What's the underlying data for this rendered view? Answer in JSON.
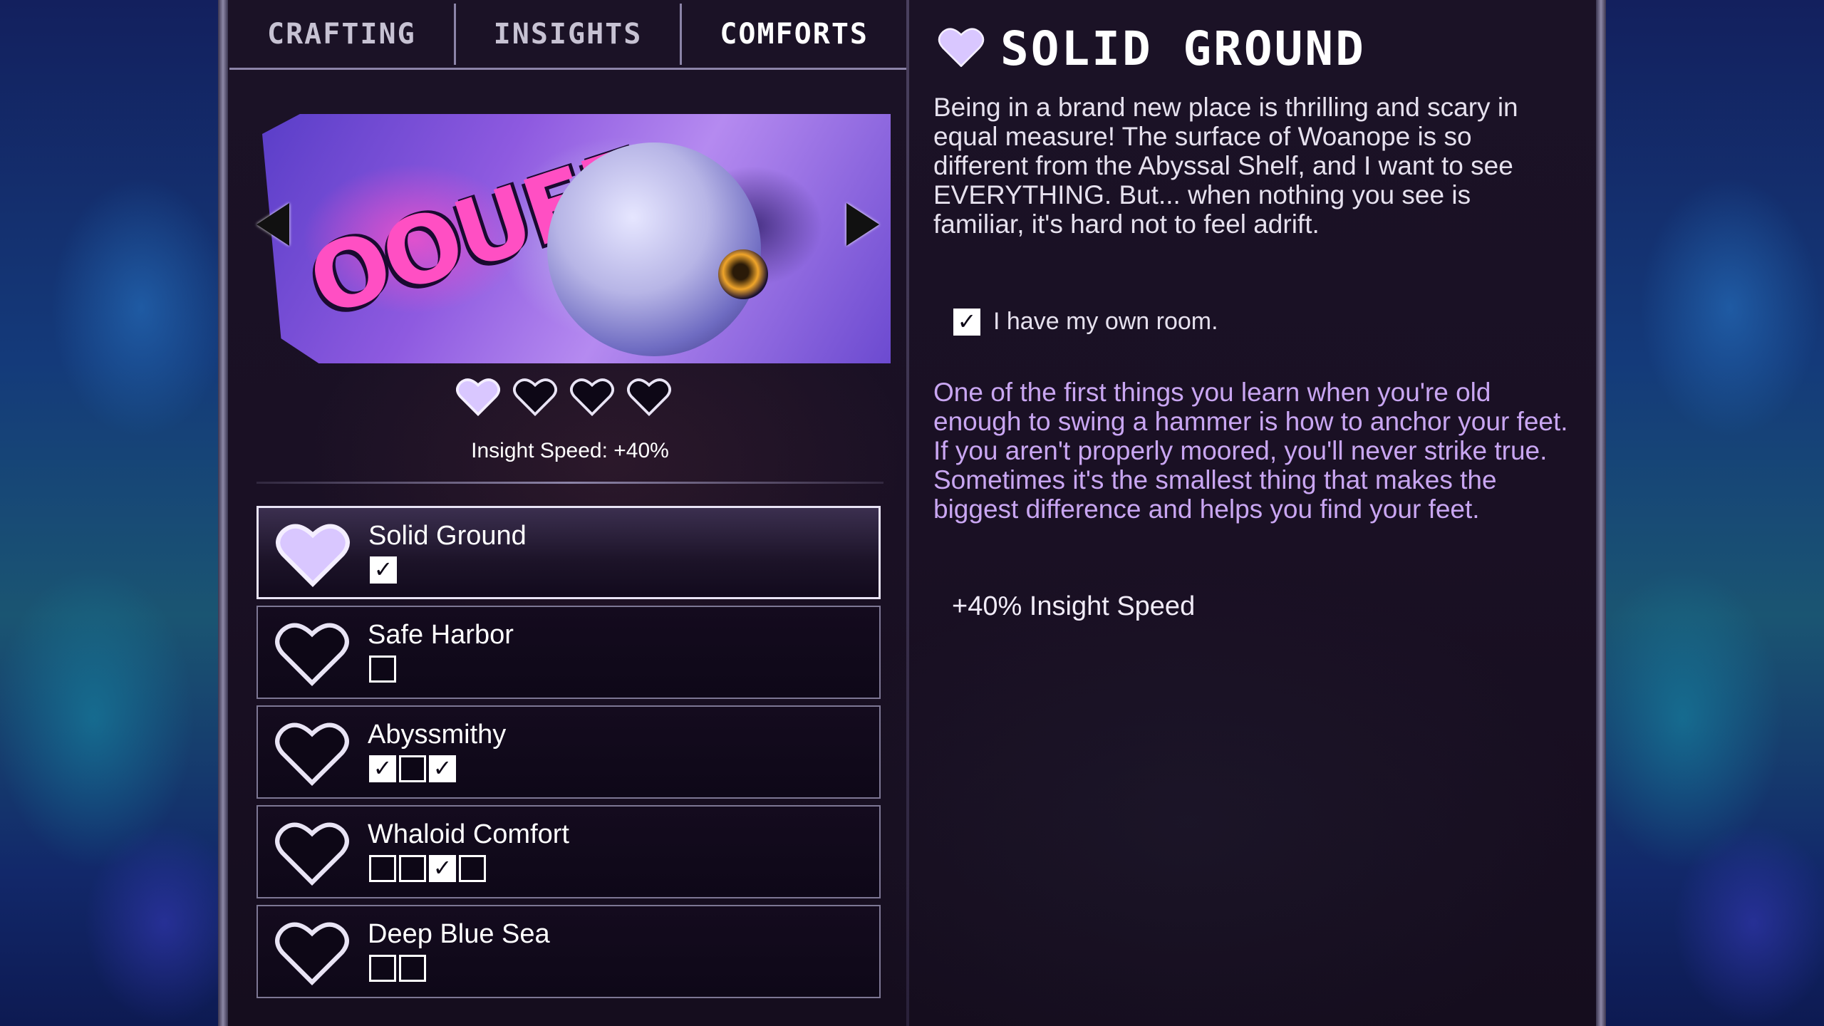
{
  "tabs": [
    {
      "label": "CRAFTING",
      "active": false
    },
    {
      "label": "INSIGHTS",
      "active": false
    },
    {
      "label": "COMFORTS",
      "active": true
    }
  ],
  "banner": {
    "art_text": "OOUFF"
  },
  "level_hearts": {
    "filled": 1,
    "total": 4
  },
  "insight_speed_label": "Insight Speed: +40%",
  "comforts": [
    {
      "name": "Solid Ground",
      "selected": true,
      "heart": "filled",
      "boxes": [
        true
      ]
    },
    {
      "name": "Safe Harbor",
      "selected": false,
      "heart": "empty",
      "boxes": [
        false
      ]
    },
    {
      "name": "Abyssmithy",
      "selected": false,
      "heart": "empty",
      "boxes": [
        true,
        false,
        true
      ]
    },
    {
      "name": "Whaloid Comfort",
      "selected": false,
      "heart": "empty",
      "boxes": [
        false,
        false,
        true,
        false
      ]
    },
    {
      "name": "Deep Blue Sea",
      "selected": false,
      "heart": "empty",
      "boxes": [
        false,
        false
      ]
    }
  ],
  "detail": {
    "title": "SOLID GROUND",
    "description": "Being in a brand new place is thrilling and scary in equal measure! The surface of Woanope is so different from the Abyssal Shelf, and I want to see EVERYTHING. But... when nothing you see is familiar, it's hard not to feel adrift.",
    "requirement": "I have my own room.",
    "requirement_met": true,
    "lore": "One of the first things you learn when you're old enough to swing a hammer is how to anchor your feet. If you aren't properly moored, you'll never strike true. Sometimes it's the smallest thing that makes the biggest difference and helps you find your feet.",
    "bonus": "+40% Insight Speed"
  },
  "colors": {
    "heart_fill": "#d9c7ff",
    "lore_text": "#c9a6f2",
    "border": "#8c84a8"
  },
  "icons": {
    "heart": "heart-icon",
    "arrow_left": "arrow-left-icon",
    "arrow_right": "arrow-right-icon",
    "checkbox": "checkbox-icon"
  }
}
